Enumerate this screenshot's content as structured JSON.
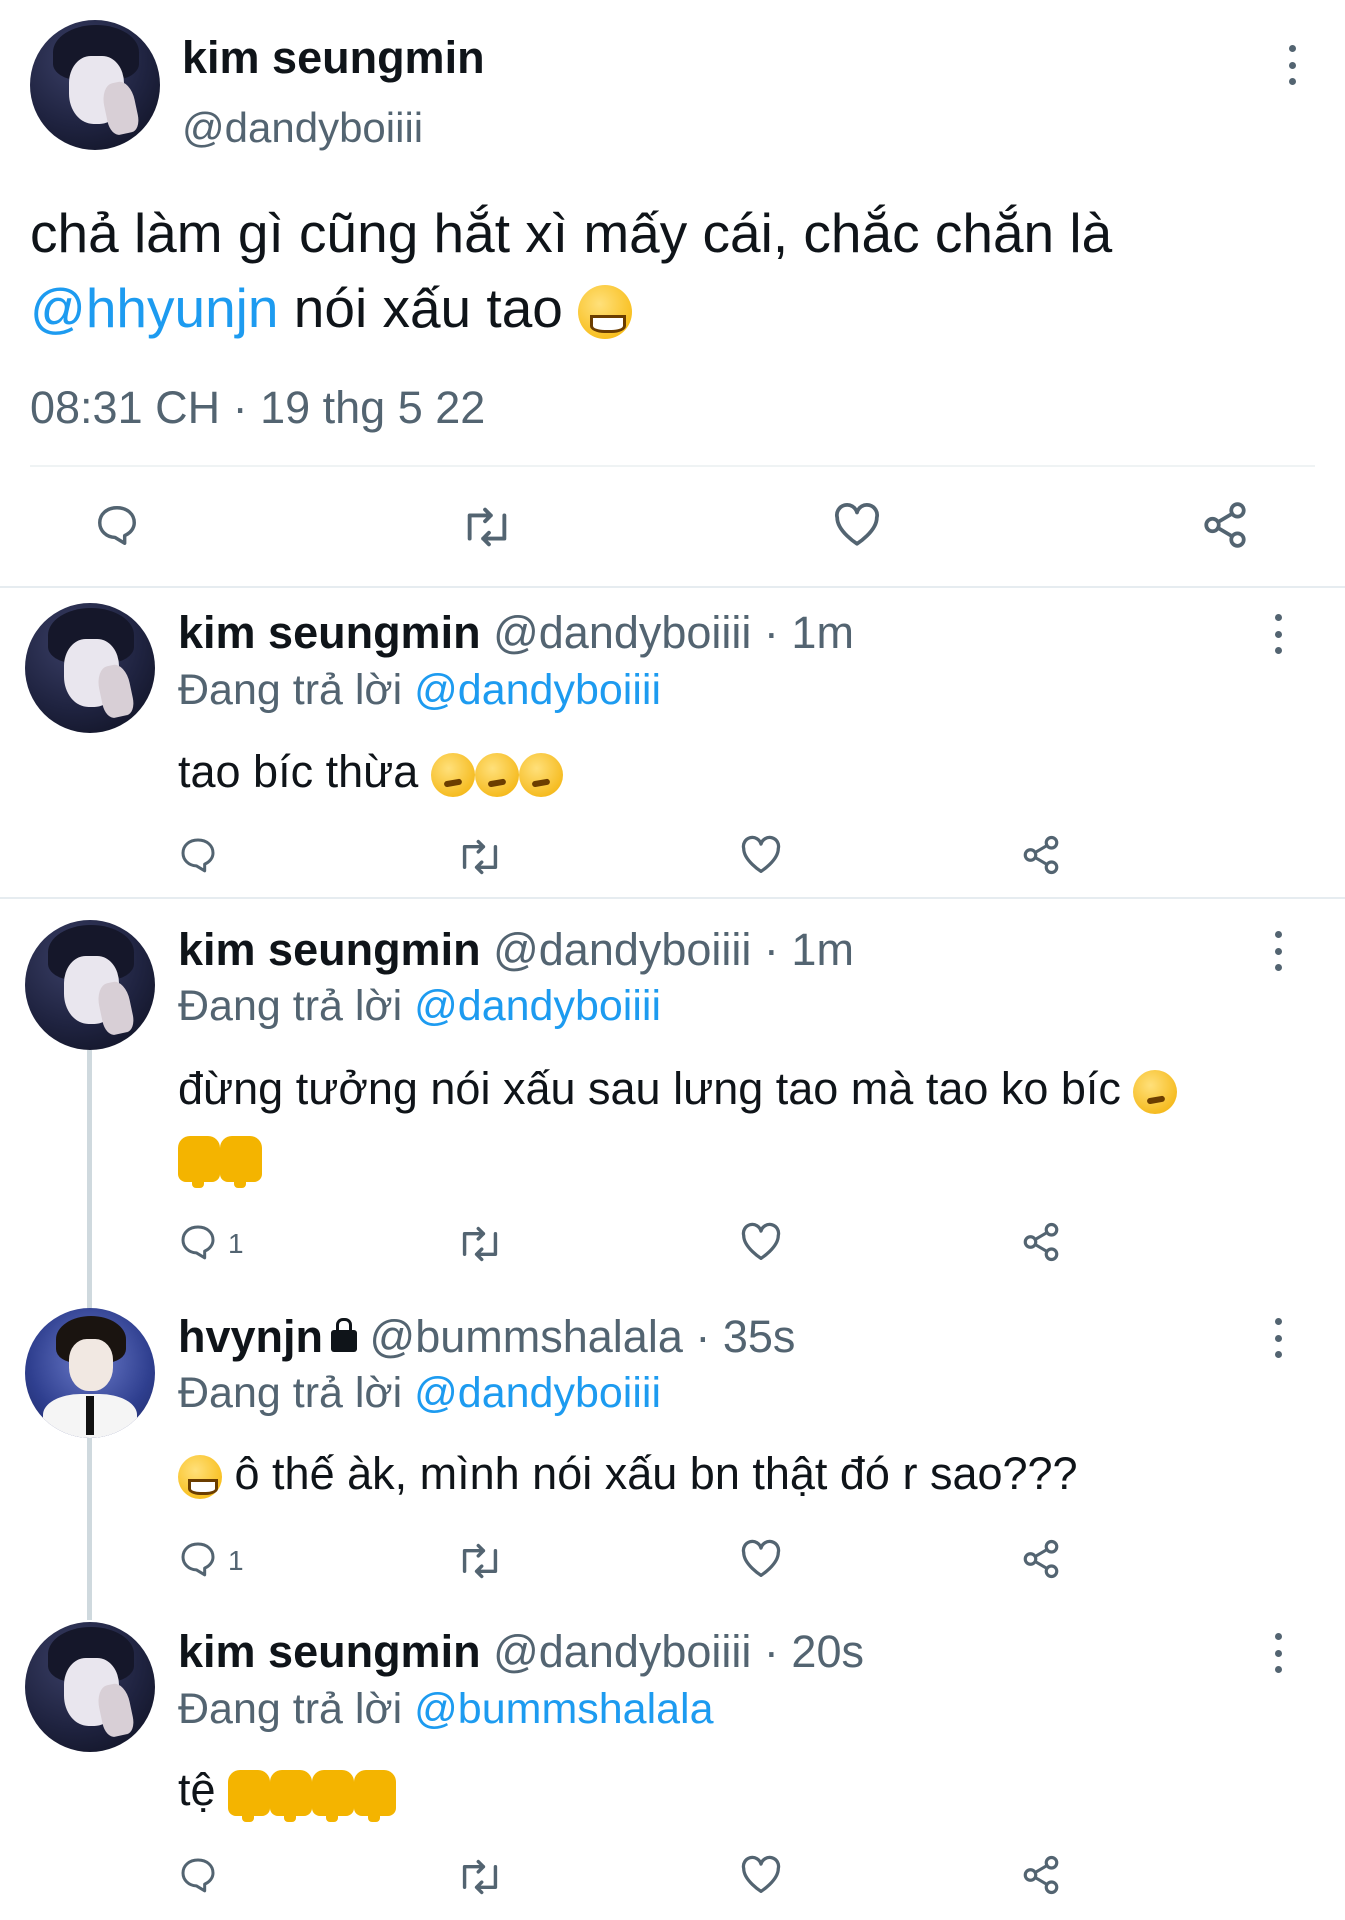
{
  "main_tweet": {
    "author_name": "kim seungmin",
    "author_handle": "@dandyboiiii",
    "text_before": "chả làm gì cũng hắt xì mấy cái, chắc chắn là",
    "mention": "@hhyunjn",
    "text_after": "nói xấu tao",
    "timestamp": "08:31 CH · 19 thg 5 22"
  },
  "replies": [
    {
      "author_name": "kim seungmin",
      "meta": "@dandyboiiii · 1m",
      "replying_prefix": "Đang trả lời",
      "replying_to": "@dandyboiiii",
      "text": "tao bíc thừa",
      "reply_count": ""
    },
    {
      "author_name": "kim seungmin",
      "meta": "@dandyboiiii · 1m",
      "replying_prefix": "Đang trả lời",
      "replying_to": "@dandyboiiii",
      "text": "đừng tưởng nói xấu sau lưng tao mà tao ko bíc",
      "reply_count": "1"
    },
    {
      "author_name": "hvynjn",
      "meta": "@bummshalala · 35s",
      "replying_prefix": "Đang trả lời",
      "replying_to": "@dandyboiiii",
      "text": "ô thế àk, mình nói xấu bn thật đó r sao???",
      "reply_count": "1"
    },
    {
      "author_name": "kim seungmin",
      "meta": "@dandyboiiii · 20s",
      "replying_prefix": "Đang trả lời",
      "replying_to": "@bummshalala",
      "text": "tệ",
      "reply_count": ""
    }
  ],
  "icons": [
    "reply-icon",
    "retweet-icon",
    "like-icon",
    "share-icon",
    "more-icon",
    "lock-icon"
  ],
  "colors": {
    "accent": "#1d9bf0",
    "secondary_text": "#536471",
    "primary_text": "#0f1419"
  }
}
